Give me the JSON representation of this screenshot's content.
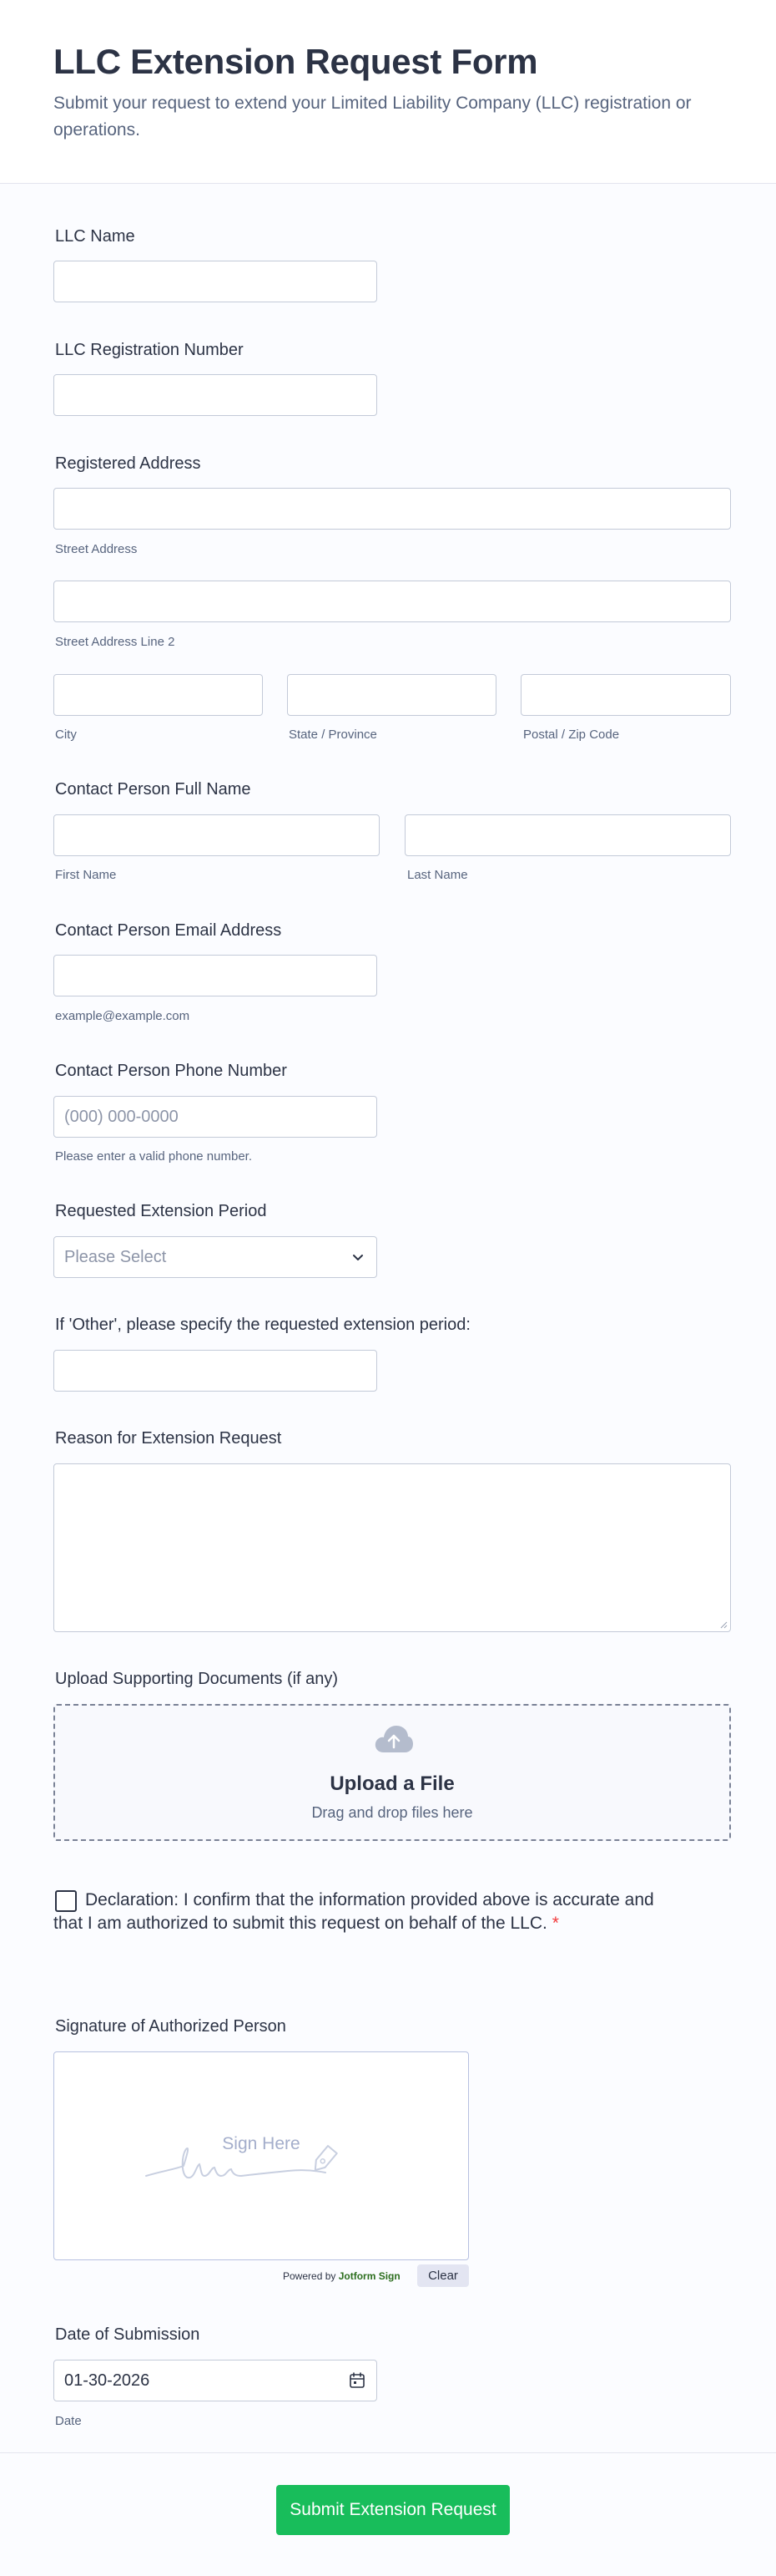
{
  "header": {
    "title": "LLC Extension Request Form",
    "subtitle": "Submit your request to extend your Limited Liability Company (LLC) registration or operations."
  },
  "fields": {
    "llc_name": {
      "label": "LLC Name",
      "value": ""
    },
    "llc_reg": {
      "label": "LLC Registration Number",
      "value": ""
    },
    "address": {
      "label": "Registered Address",
      "street": "Street Address",
      "street2": "Street Address Line 2",
      "city": "City",
      "state": "State / Province",
      "postal": "Postal / Zip Code"
    },
    "contact_name": {
      "label": "Contact Person Full Name",
      "first": "First Name",
      "last": "Last Name"
    },
    "email": {
      "label": "Contact Person Email Address",
      "sublabel": "example@example.com"
    },
    "phone": {
      "label": "Contact Person Phone Number",
      "placeholder": "(000) 000-0000",
      "sublabel": "Please enter a valid phone number."
    },
    "period": {
      "label": "Requested Extension Period",
      "placeholder": "Please Select"
    },
    "other": {
      "label": "If 'Other', please specify the requested extension period:"
    },
    "reason": {
      "label": "Reason for Extension Request"
    },
    "upload": {
      "label": "Upload Supporting Documents (if any)",
      "title": "Upload a File",
      "subtitle": "Drag and drop files here"
    },
    "declaration": {
      "text": "Declaration: I confirm that the information provided above is accurate and that I am authorized to submit this request on behalf of the LLC.",
      "required_mark": "*"
    },
    "signature": {
      "label": "Signature of Authorized Person",
      "hint": "Sign Here",
      "powered_prefix": "Powered by",
      "powered_brand": "Jotform Sign",
      "clear_label": "Clear"
    },
    "date": {
      "label": "Date of Submission",
      "value": "01-30-2026",
      "sublabel": "Date"
    }
  },
  "submit": {
    "label": "Submit Extension Request"
  },
  "colors": {
    "accent": "#18bd5b",
    "required": "#f23a3c",
    "text": "#2c3345",
    "muted": "#57647e"
  }
}
